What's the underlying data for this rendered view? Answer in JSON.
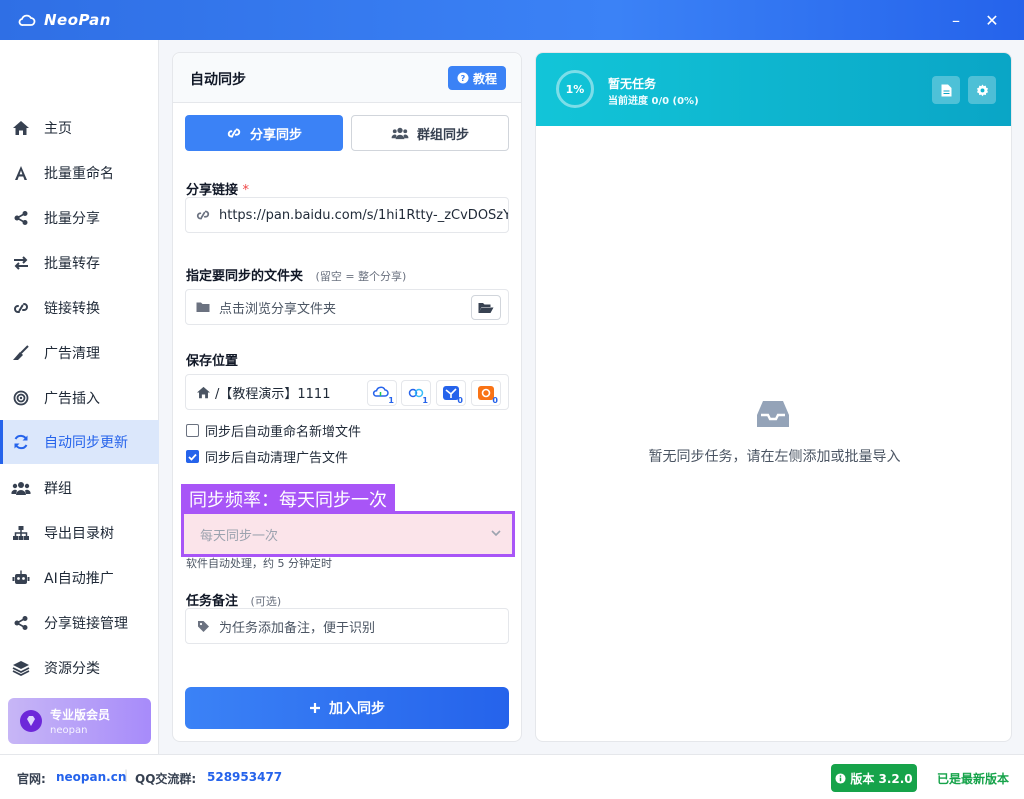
{
  "app": {
    "name": "NeoPan",
    "minimize": "–",
    "close": "✕"
  },
  "sidebar": {
    "items": [
      {
        "label": "主页",
        "icon": "home-icon"
      },
      {
        "label": "批量重命名",
        "icon": "font-icon"
      },
      {
        "label": "批量分享",
        "icon": "share-icon"
      },
      {
        "label": "批量转存",
        "icon": "exchange-icon"
      },
      {
        "label": "链接转换",
        "icon": "link-icon"
      },
      {
        "label": "广告清理",
        "icon": "broom-icon"
      },
      {
        "label": "广告插入",
        "icon": "bullseye-icon"
      },
      {
        "label": "自动同步更新",
        "icon": "sync-icon",
        "active": true
      },
      {
        "label": "群组",
        "icon": "users-icon"
      },
      {
        "label": "导出目录树",
        "icon": "sitemap-icon"
      },
      {
        "label": "AI自动推广",
        "icon": "robot-icon"
      },
      {
        "label": "分享链接管理",
        "icon": "share-icon"
      },
      {
        "label": "资源分类",
        "icon": "layers-icon"
      }
    ],
    "pro": {
      "title": "专业版会员",
      "sub": "neopan"
    }
  },
  "sync_panel": {
    "title": "自动同步",
    "tutorial": "教程",
    "tabs": [
      "分享同步",
      "群组同步"
    ],
    "share_link_label": "分享链接",
    "share_link_required": "*",
    "share_link_value": "https://pan.baidu.com/s/1hi1Rtty-_zCvDOSzY",
    "folder_label": "指定要同步的文件夹",
    "folder_hint": "(留空 = 整个分享)",
    "folder_placeholder": "点击浏览分享文件夹",
    "save_label": "保存位置",
    "save_path": "/【教程演示】1111",
    "cloud_badges": [
      "1",
      "1",
      "0",
      "0"
    ],
    "checkbox_rename": "同步后自动重命名新增文件",
    "checkbox_rename_checked": false,
    "checkbox_clean": "同步后自动清理广告文件",
    "checkbox_clean_checked": true,
    "frequency_tag": "同步频率：每天同步一次",
    "frequency_value": "每天同步一次",
    "frequency_note": "软件自动处理，约 5 分钟定时",
    "note_label": "任务备注",
    "note_hint": "(可选)",
    "note_placeholder": "为任务添加备注，便于识别",
    "submit_label": "加入同步"
  },
  "task_panel": {
    "progress_text": "1%",
    "progress_value": 0.01,
    "title": "暂无任务",
    "sub": "当前进度 0/0 (0%)",
    "empty_text": "暂无同步任务，请在左侧添加或批量导入"
  },
  "footer": {
    "site_label": "官网:",
    "site_value": "neopan.cn",
    "qq_label": "QQ交流群:",
    "qq_value": "528953477",
    "version": "版本 3.2.0",
    "latest": "已是最新版本"
  },
  "colors": {
    "primary": "#3b82f6",
    "accent": "#a855f7",
    "teal": "#12c5d8",
    "success": "#16a34a"
  }
}
